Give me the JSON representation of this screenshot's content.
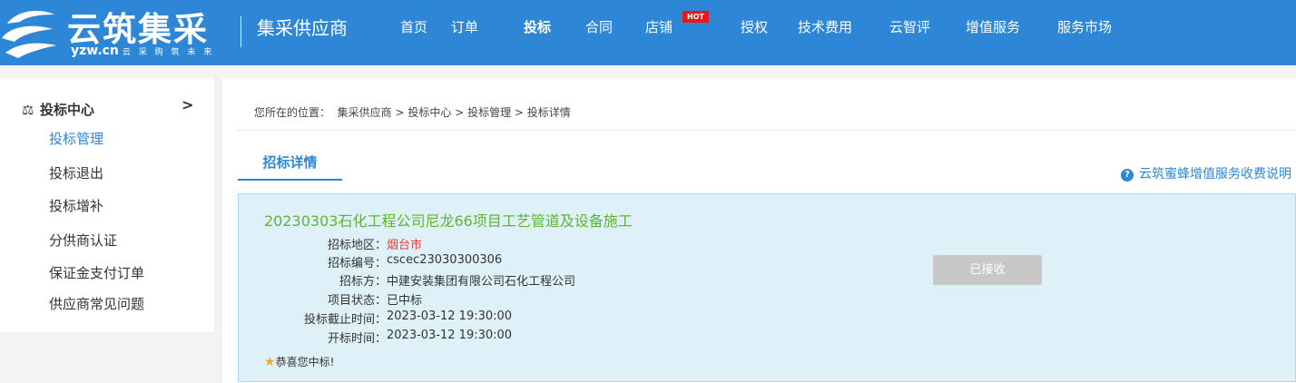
{
  "header": {
    "logo_title": "云筑集采",
    "logo_domain": "yzw.cn",
    "logo_tagline": "云 采 购 筑 未 来",
    "brand": "集采供应商",
    "nav": [
      "首页",
      "订单",
      "投标",
      "合同",
      "店铺",
      "授权",
      "技术费用",
      "云智评",
      "增值服务",
      "服务市场"
    ],
    "active_nav": "投标",
    "hot_badge": "HOT"
  },
  "sidebar": {
    "title": "投标中心",
    "items": [
      "投标管理",
      "投标退出",
      "投标增补",
      "分供商认证",
      "保证金支付订单",
      "供应商常见问题"
    ],
    "active_item": "投标管理"
  },
  "breadcrumb": {
    "prefix": "您所在的位置：",
    "path": [
      "集采供应商",
      "投标中心",
      "投标管理",
      "投标详情"
    ]
  },
  "tab": {
    "label": "招标详情"
  },
  "help_link": "云筑蜜蜂增值服务收费说明",
  "tender": {
    "title": "20230303石化工程公司尼龙66项目工艺管道及设备施工",
    "fields": [
      {
        "label": "招标地区：",
        "value": "烟台市",
        "highlight": true
      },
      {
        "label": "招标编号：",
        "value": "cscec23030300306"
      },
      {
        "label": "招标方：",
        "value": "中建安装集团有限公司石化工程公司"
      },
      {
        "label": "项目状态：",
        "value": "已中标"
      },
      {
        "label": "投标截止时间：",
        "value": "2023-03-12 19:30:00"
      },
      {
        "label": "开标时间：",
        "value": "2023-03-12 19:30:00"
      }
    ],
    "status_button": "已接收",
    "congrats": "恭喜您中标!"
  },
  "colors": {
    "primary": "#2d86d6",
    "title_green": "#5cb531",
    "highlight_red": "#e83a3a",
    "card_bg": "#dff1f8"
  }
}
